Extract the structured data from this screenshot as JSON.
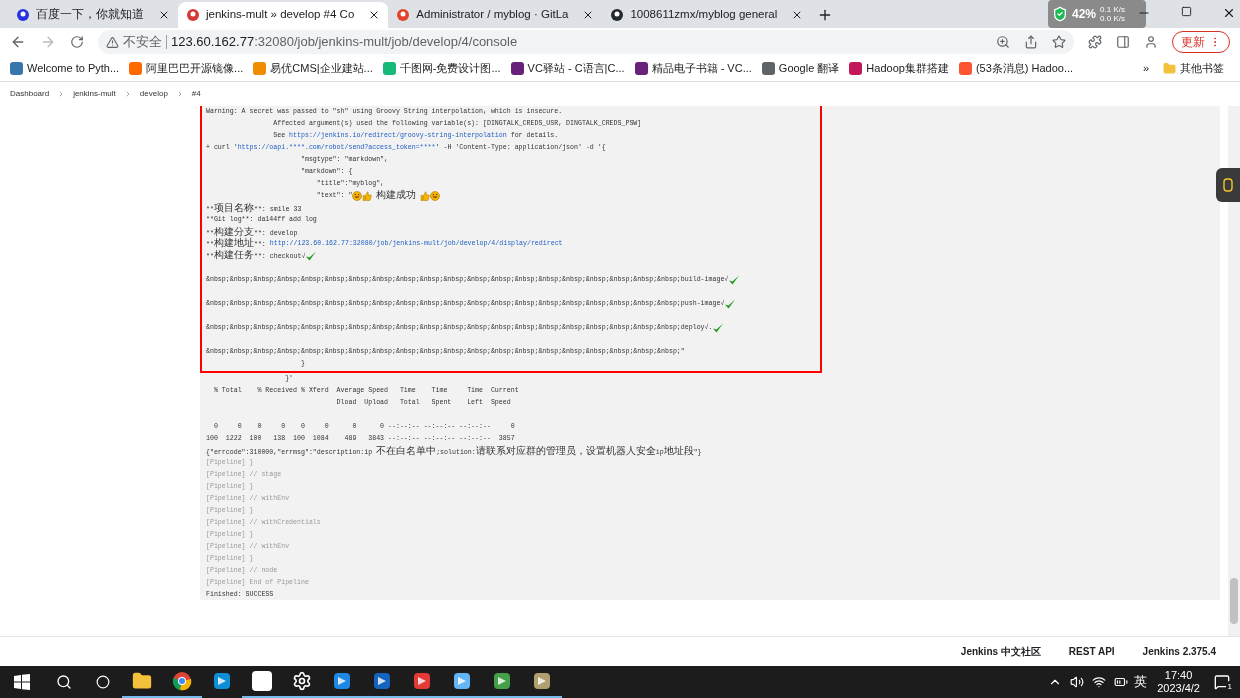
{
  "tabs": [
    {
      "title": "百度一下，你就知道",
      "selected": false,
      "kind": "paw"
    },
    {
      "title": "jenkins-mult » develop #4 Co",
      "selected": true,
      "kind": "butler"
    },
    {
      "title": "Administrator / myblog · GitLa",
      "selected": false,
      "kind": "fox"
    },
    {
      "title": "1008611zmx/myblog general",
      "selected": false,
      "kind": "cat"
    }
  ],
  "net_widget": {
    "percent": "42%",
    "up": "0.1 K/s",
    "down": "0.0 K/s"
  },
  "address": {
    "security": "不安全",
    "host": "123.60.162.77",
    "path": ":32080/job/jenkins-mult/job/develop/4/console"
  },
  "update_button": "更新",
  "bookmarks": [
    {
      "label": "Welcome to Pyth...",
      "color": "#3776ab"
    },
    {
      "label": "阿里巴巴开源镜像...",
      "color": "#ff6a00"
    },
    {
      "label": "易优CMS|企业建站...",
      "color": "#f08c00"
    },
    {
      "label": "千图网-免费设计图...",
      "color": "#17b978"
    },
    {
      "label": "VC驿站 - C语言|C...",
      "color": "#68217a"
    },
    {
      "label": "精品电子书籍 - VC...",
      "color": "#68217a"
    },
    {
      "label": "Google 翻译",
      "color": "#5f6368"
    },
    {
      "label": "Hadoop集群搭建",
      "color": "#c2185b"
    },
    {
      "label": "(53条消息) Hadoo...",
      "color": "#fc5531"
    }
  ],
  "bookmarks_more": "»",
  "other_bookmarks": "其他书签",
  "breadcrumb": [
    "Dashboard",
    "jenkins-mult",
    "develop",
    "#4"
  ],
  "console": {
    "marked_lines": [
      [
        {
          "kind": "plain",
          "text": "Warning: A secret was passed to \"sh\" using Groovy String interpolation, which is insecure."
        }
      ],
      [
        {
          "kind": "plain",
          "text": "                 Affected argument(s) used the following variable(s): [DINGTALK_CREDS_USR, DINGTALK_CREDS_PSW]"
        }
      ],
      [
        {
          "kind": "plain",
          "text": "                 See "
        },
        {
          "kind": "link",
          "text": "https://jenkins.io/redirect/groovy-string-interpolation"
        },
        {
          "kind": "plain",
          "text": " for details."
        }
      ],
      [
        {
          "kind": "plain",
          "text": "+ curl '"
        },
        {
          "kind": "link",
          "text": "https://oapi.****.com/robot/send?access_token=****"
        },
        {
          "kind": "plain",
          "text": "' -H 'Content-Type: application/json' -d '{"
        }
      ],
      [
        {
          "kind": "plain",
          "text": "                        \"msgtype\": \"markdown\","
        }
      ],
      [
        {
          "kind": "plain",
          "text": "                        \"markdown\": {"
        }
      ],
      [
        {
          "kind": "plain",
          "text": "                            \"title\":\"myblog\","
        }
      ],
      [
        {
          "kind": "plain",
          "text": "                            \"text\": \""
        },
        {
          "kind": "grin"
        },
        {
          "kind": "thumb"
        },
        {
          "kind": "plain",
          "text": " 构建成功 "
        },
        {
          "kind": "thumb"
        },
        {
          "kind": "grin"
        }
      ],
      [
        {
          "kind": "plain",
          "text": "**项目名称**: smile 33"
        }
      ],
      [
        {
          "kind": "plain",
          "text": "**Git log**: da144ff add log"
        }
      ],
      [
        {
          "kind": "plain",
          "text": "**构建分支**: develop"
        }
      ],
      [
        {
          "kind": "plain",
          "text": "**构建地址**: "
        },
        {
          "kind": "link",
          "text": "http://123.60.162.77:32080/job/jenkins-mult/job/develop/4/display/redirect"
        }
      ],
      [
        {
          "kind": "plain",
          "text": "**构建任务**: checkout√"
        },
        {
          "kind": "check"
        }
      ],
      [
        {
          "kind": "blank"
        }
      ],
      [
        {
          "kind": "plain",
          "text": "&nbsp;&nbsp;&nbsp;&nbsp;&nbsp;&nbsp;&nbsp;&nbsp;&nbsp;&nbsp;&nbsp;&nbsp;&nbsp;&nbsp;&nbsp;&nbsp;&nbsp;&nbsp;&nbsp;&nbsp;build-image√"
        },
        {
          "kind": "check"
        }
      ],
      [
        {
          "kind": "blank"
        }
      ],
      [
        {
          "kind": "plain",
          "text": "&nbsp;&nbsp;&nbsp;&nbsp;&nbsp;&nbsp;&nbsp;&nbsp;&nbsp;&nbsp;&nbsp;&nbsp;&nbsp;&nbsp;&nbsp;&nbsp;&nbsp;&nbsp;&nbsp;&nbsp;push-image√"
        },
        {
          "kind": "check"
        }
      ],
      [
        {
          "kind": "blank"
        }
      ],
      [
        {
          "kind": "plain",
          "text": "&nbsp;&nbsp;&nbsp;&nbsp;&nbsp;&nbsp;&nbsp;&nbsp;&nbsp;&nbsp;&nbsp;&nbsp;&nbsp;&nbsp;&nbsp;&nbsp;&nbsp;&nbsp;&nbsp;&nbsp;deploy√."
        },
        {
          "kind": "check"
        }
      ],
      [
        {
          "kind": "blank"
        }
      ],
      [
        {
          "kind": "plain",
          "text": "&nbsp;&nbsp;&nbsp;&nbsp;&nbsp;&nbsp;&nbsp;&nbsp;&nbsp;&nbsp;&nbsp;&nbsp;&nbsp;&nbsp;&nbsp;&nbsp;&nbsp;&nbsp;&nbsp;&nbsp;\""
        }
      ],
      [
        {
          "kind": "plain",
          "text": "                        }"
        }
      ]
    ],
    "lines": [
      [
        {
          "kind": "plain",
          "text": "                    }'"
        }
      ],
      [
        {
          "kind": "plain",
          "text": "  % Total    % Received % Xferd  Average Speed   Time    Time     Time  Current"
        }
      ],
      [
        {
          "kind": "plain",
          "text": "                                 Dload  Upload   Total   Spent    Left  Speed"
        }
      ],
      [
        {
          "kind": "blank"
        }
      ],
      [
        {
          "kind": "plain",
          "text": "  0     0    0     0    0     0      0      0 --:--:-- --:--:-- --:--:--     0"
        }
      ],
      [
        {
          "kind": "plain",
          "text": "100  1222  100   138  100  1084    489   3843 --:--:-- --:--:-- --:--:--  3857"
        }
      ],
      [
        {
          "kind": "plain",
          "text": "{\"errcode\":310000,\"errmsg\":\"description:ip 不在白名单中;solution:请联系对应群的管理员，设置机器人安全ip地址段\"}"
        }
      ],
      [
        {
          "kind": "pipeline",
          "text": "[Pipeline] }"
        }
      ],
      [
        {
          "kind": "pipeline",
          "text": "[Pipeline] // stage"
        }
      ],
      [
        {
          "kind": "pipeline",
          "text": "[Pipeline] }"
        }
      ],
      [
        {
          "kind": "pipeline",
          "text": "[Pipeline] // withEnv"
        }
      ],
      [
        {
          "kind": "pipeline",
          "text": "[Pipeline] }"
        }
      ],
      [
        {
          "kind": "pipeline",
          "text": "[Pipeline] // withCredentials"
        }
      ],
      [
        {
          "kind": "pipeline",
          "text": "[Pipeline] }"
        }
      ],
      [
        {
          "kind": "pipeline",
          "text": "[Pipeline] // withEnv"
        }
      ],
      [
        {
          "kind": "pipeline",
          "text": "[Pipeline] }"
        }
      ],
      [
        {
          "kind": "pipeline",
          "text": "[Pipeline] // node"
        }
      ],
      [
        {
          "kind": "pipeline",
          "text": "[Pipeline] End of Pipeline"
        }
      ],
      [
        {
          "kind": "plain",
          "text": "Finished: SUCCESS"
        }
      ]
    ]
  },
  "footer": [
    "Jenkins 中文社区",
    "REST API",
    "Jenkins 2.375.4"
  ],
  "taskbar": {
    "apps": [
      {
        "kind": "folder",
        "running": true
      },
      {
        "kind": "chrome",
        "running": true
      },
      {
        "kind": "edge",
        "running": false
      },
      {
        "kind": "typora",
        "running": true
      },
      {
        "kind": "gear",
        "running": true
      },
      {
        "kind": "arrow",
        "running": true
      },
      {
        "kind": "player",
        "running": true
      },
      {
        "kind": "swirl",
        "running": true
      },
      {
        "kind": "book",
        "running": true
      },
      {
        "kind": "lock",
        "running": true
      },
      {
        "kind": "map",
        "running": true
      }
    ],
    "ime": "英",
    "time": "17:40",
    "date": "2023/4/2",
    "notifications": "1"
  }
}
